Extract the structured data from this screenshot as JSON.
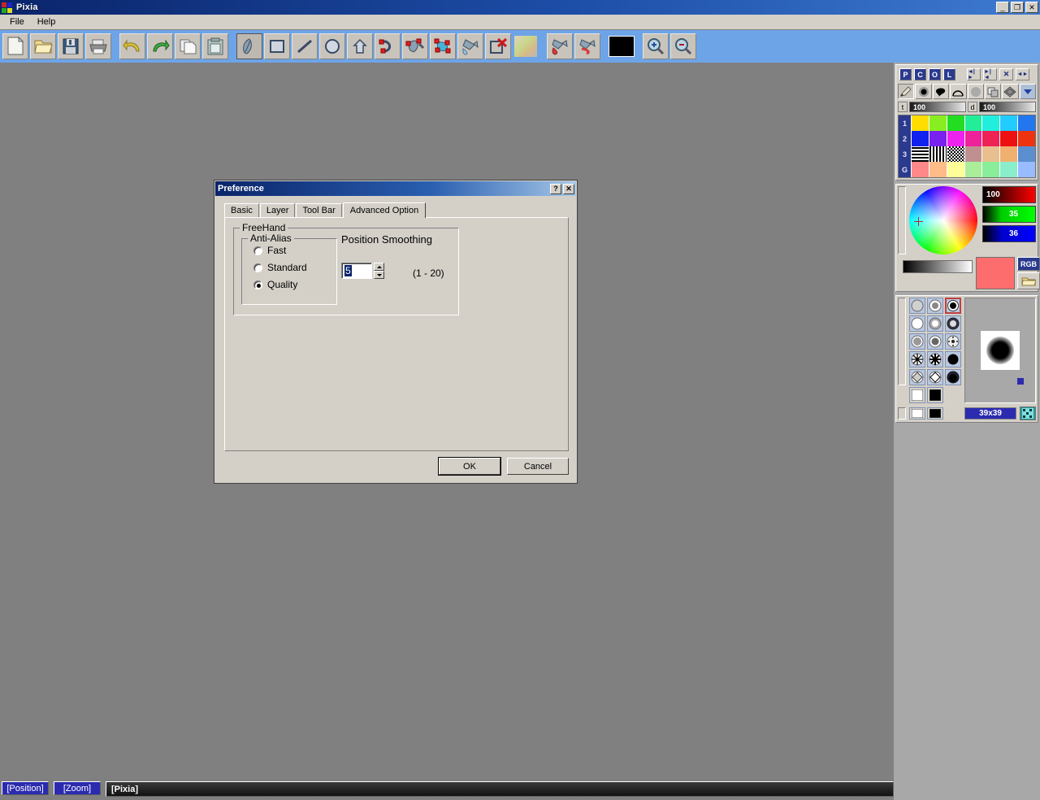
{
  "window": {
    "title": "Pixia",
    "logo_icon": "pixia-logo-icon",
    "minimize_label": "_",
    "maximize_label": "❐",
    "close_label": "✕"
  },
  "menubar": {
    "items": [
      {
        "label": "File"
      },
      {
        "label": "Help"
      }
    ]
  },
  "toolbar": {
    "buttons": [
      {
        "name": "new-file-button",
        "icon": "new-document-icon"
      },
      {
        "name": "open-file-button",
        "icon": "open-folder-icon"
      },
      {
        "name": "save-file-button",
        "icon": "floppy-disk-icon"
      },
      {
        "name": "print-button",
        "icon": "printer-icon"
      },
      {
        "name": "undo-button",
        "icon": "undo-arrow-icon"
      },
      {
        "name": "redo-button",
        "icon": "redo-arrow-icon"
      },
      {
        "name": "copy-button",
        "icon": "copy-pages-icon"
      },
      {
        "name": "paste-button",
        "icon": "paste-clipboard-icon"
      },
      {
        "name": "freehand-brush-tool",
        "icon": "brush-icon"
      },
      {
        "name": "rectangle-tool",
        "icon": "square-icon"
      },
      {
        "name": "line-tool",
        "icon": "diagonal-line-icon"
      },
      {
        "name": "ellipse-tool",
        "icon": "circle-icon"
      },
      {
        "name": "polygon-tool",
        "icon": "pentagon-icon"
      },
      {
        "name": "curve-tool",
        "icon": "bezier-curve-icon"
      },
      {
        "name": "spline-brush-tool",
        "icon": "spline-brush-icon"
      },
      {
        "name": "polygon-fill-tool",
        "icon": "polygon-fill-icon"
      },
      {
        "name": "fill-tool",
        "icon": "paint-bucket-icon"
      },
      {
        "name": "clear-tool",
        "icon": "clear-rect-icon"
      },
      {
        "name": "gradient-tool",
        "icon": "checker-gradient-icon"
      },
      {
        "name": "pour-color-tool",
        "icon": "pour-bucket-icon"
      },
      {
        "name": "pour-line-tool",
        "icon": "pour-line-icon"
      },
      {
        "name": "current-color-swatch",
        "icon": "color-swatch-icon"
      },
      {
        "name": "zoom-in-button",
        "icon": "magnifier-plus-icon"
      },
      {
        "name": "zoom-out-button",
        "icon": "magnifier-minus-icon"
      }
    ]
  },
  "right_panel": {
    "nav_buttons": [
      {
        "label": "P",
        "name": "panel-p-button"
      },
      {
        "label": "C",
        "name": "panel-c-button"
      },
      {
        "label": "O",
        "name": "panel-o-button"
      },
      {
        "label": "L",
        "name": "panel-l-button"
      }
    ],
    "nav_icons": [
      {
        "name": "expand-horizontal-icon",
        "glyph": "◄|►"
      },
      {
        "name": "collapse-horizontal-icon",
        "glyph": "►|◄"
      },
      {
        "name": "close-panel-icon",
        "glyph": "✕"
      },
      {
        "name": "toggle-panel-icon",
        "glyph": "◄►"
      }
    ],
    "brush_tools": [
      {
        "name": "pencil-tool",
        "icon": "pencil-icon"
      },
      {
        "name": "solid-dot-tool",
        "icon": "solid-dot-icon"
      },
      {
        "name": "blob-tool",
        "icon": "blob-icon"
      },
      {
        "name": "arc-tool",
        "icon": "arc-icon"
      },
      {
        "name": "soft-dot-tool",
        "icon": "soft-dot-icon"
      },
      {
        "name": "layer-tool",
        "icon": "layers-icon"
      },
      {
        "name": "diamond-tool",
        "icon": "diamond-icon"
      },
      {
        "name": "dropdown-tool",
        "icon": "chevron-down-icon"
      }
    ],
    "sliders": [
      {
        "label": "t",
        "value": "100",
        "name": "thickness-slider"
      },
      {
        "label": "d",
        "value": "100",
        "name": "density-slider"
      }
    ],
    "palette": {
      "rows": [
        {
          "label": "1",
          "colors": [
            "#ffdd00",
            "#88ee22",
            "#22dd22",
            "#22ee99",
            "#22eedd",
            "#22ccff",
            "#2277ee"
          ]
        },
        {
          "label": "2",
          "colors": [
            "#1122ee",
            "#7722ee",
            "#ee22ee",
            "#ee2299",
            "#ee2255",
            "#ee1111",
            "#ee3311"
          ]
        },
        {
          "label": "3",
          "colors": [
            "#ffffff",
            "#dddddd",
            "#222222",
            "#c09090",
            "#e8b070",
            "#f0b070",
            "#88bbee"
          ]
        },
        {
          "label": "G",
          "colors": [
            "#ff8888",
            "#ffbb88",
            "#ffff99",
            "#aaee99",
            "#88ee99",
            "#88eecc",
            "#99bbff"
          ]
        }
      ]
    },
    "color_mixer": {
      "channels": [
        {
          "name": "red-channel",
          "value": "100"
        },
        {
          "name": "green-channel",
          "value": "35"
        },
        {
          "name": "blue-channel",
          "value": "36"
        }
      ],
      "mode_button": "RGB",
      "current_color": "#fd6d6d",
      "load_icon": "folder-open-icon"
    },
    "brush_shapes": {
      "selected_index": 2,
      "size_label": "39x39",
      "grid_icon": "grid-pattern-icon"
    }
  },
  "statusbar": {
    "position_label": "[Position]",
    "zoom_label": "[Zoom]",
    "document_label": "[Pixia]"
  },
  "dialog": {
    "title": "Preference",
    "help_label": "?",
    "close_label": "✕",
    "tabs": [
      {
        "label": "Basic",
        "active": false
      },
      {
        "label": "Layer",
        "active": false
      },
      {
        "label": "Tool Bar",
        "active": false
      },
      {
        "label": "Advanced Option",
        "active": true
      }
    ],
    "freehand_group": "FreeHand",
    "antialias_group": "Anti-Alias",
    "antialias_options": [
      {
        "label": "Fast",
        "selected": false
      },
      {
        "label": "Standard",
        "selected": false
      },
      {
        "label": "Quality",
        "selected": true
      }
    ],
    "position_smoothing_label": "Position Smoothing",
    "position_smoothing_value": "5",
    "position_smoothing_range": "(1 - 20)",
    "ok_label": "OK",
    "cancel_label": "Cancel"
  }
}
